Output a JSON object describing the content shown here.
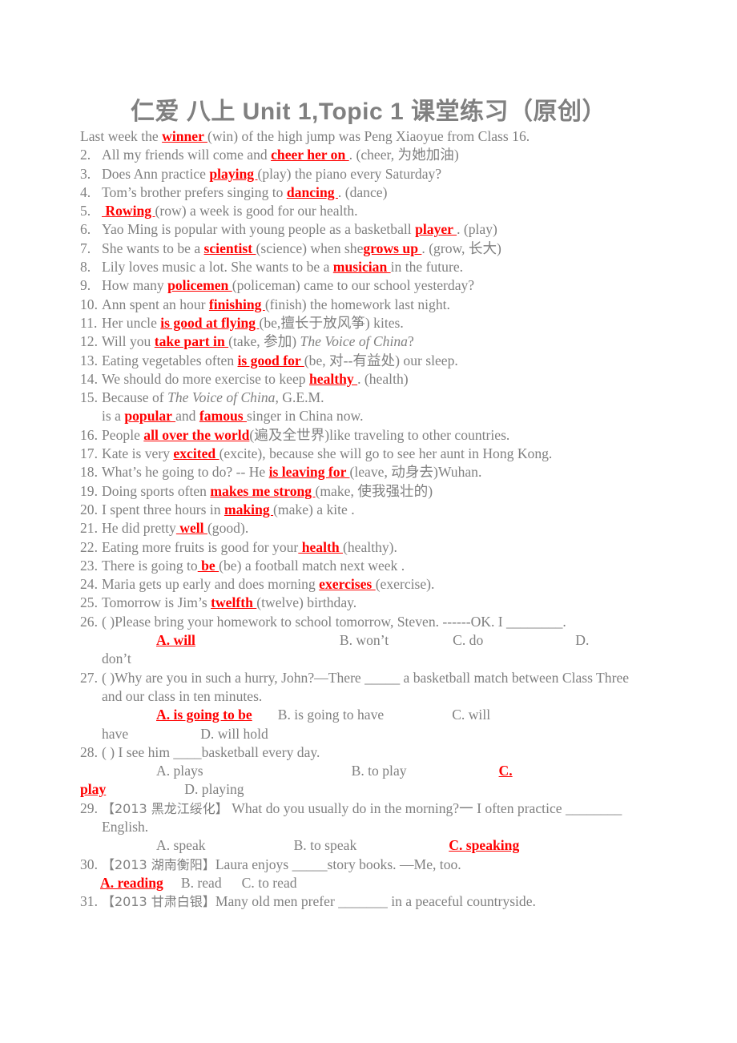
{
  "document": {
    "title": "仁爱 八上 Unit 1,Topic 1 课堂练习（原创）",
    "accent_color": "#ff0000",
    "body_color": "#808080"
  },
  "fill_in_questions": [
    {
      "number": "",
      "pre": "Last week the ",
      "answer": " winner  ",
      "post": "(win) of the high jump was Peng Xiaoyue from Class 16."
    },
    {
      "number": "2.",
      "pre": "All my friends will come and ",
      "answer": " cheer her on ",
      "post": ". (cheer, 为她加油)"
    },
    {
      "number": "3.",
      "pre": "Does Ann practice ",
      "answer": " playing  ",
      "post": "(play) the piano every Saturday?"
    },
    {
      "number": "4.",
      "pre": "Tom’s brother prefers singing to ",
      "answer": " dancing ",
      "post": ". (dance)"
    },
    {
      "number": "5.",
      "pre": "",
      "answer": "  Rowing ",
      "post": "(row) a week is good for our health."
    },
    {
      "number": "6.",
      "pre": "Yao Ming is popular with young people as a basketball ",
      "answer": "player  ",
      "post": ". (play)"
    },
    {
      "number": "7.",
      "pre": "She wants to be a ",
      "answer": "scientist ",
      "mid": "(science) when she",
      "answer2": "grows up  ",
      "post": " . (grow, 长大)"
    },
    {
      "number": "8.",
      "pre": "Lily loves music a lot. She wants to be a ",
      "answer": "musician  ",
      "post": "in the future."
    },
    {
      "number": "9.",
      "pre": "How many ",
      "answer": " policemen  ",
      "post": "(policeman) came to our school yesterday?"
    },
    {
      "number": "10.",
      "pre": "Ann spent an hour ",
      "answer": " finishing   ",
      "post": "(finish) the homework last night."
    },
    {
      "number": "11.",
      "pre": "Her uncle ",
      "answer": " is good at flying   ",
      "post": "(be,擅长于放风筝) kites."
    },
    {
      "number": "12.",
      "pre": "Will you ",
      "answer": " take part in  ",
      "post": "(take, 参加) ",
      "italic": "The Voice of China",
      "tail": "?"
    },
    {
      "number": "13.",
      "pre": "Eating vegetables often ",
      "answer": "  is good for   ",
      "post": "(be, 对--有益处) our sleep."
    },
    {
      "number": "14.",
      "pre": "We should do more exercise to keep ",
      "answer": " healthy  ",
      "post": ". (health)"
    },
    {
      "number": "15.",
      "pre": "Because of ",
      "italic": "The Voice of China",
      "post": ", G.E.M.",
      "wrap_pre": "is a ",
      "wrap_answer": "popular ",
      "wrap_mid": "and ",
      "wrap_answer2": "famous ",
      "wrap_post": "singer in China now."
    },
    {
      "number": "16.",
      "pre": "People ",
      "answer": "all over the world",
      "post": "(遍及全世界)like traveling to other countries."
    },
    {
      "number": "17.",
      "pre": "Kate is very ",
      "answer": " excited  ",
      "post": "(excite), because she will go to see her aunt in Hong Kong."
    },
    {
      "number": "18.",
      "pre": "What’s he going to do? -- He ",
      "answer": "is leaving for ",
      "post": "(leave, 动身去)Wuhan."
    },
    {
      "number": "19.",
      "pre": "Doing sports often ",
      "answer": " makes me strong  ",
      "post": "(make, 使我强壮的)"
    },
    {
      "number": "20.",
      "pre": "I spent three hours in ",
      "answer": " making ",
      "post": "(make) a  kite ."
    },
    {
      "number": "21.",
      "pre": "He did pretty",
      "answer": " well ",
      "post": "(good)."
    },
    {
      "number": "22.",
      "pre": "Eating more fruits is good for your",
      "answer": " health  ",
      "post": "(healthy)."
    },
    {
      "number": "23.",
      "pre": "There is going to",
      "answer": " be ",
      "post": "(be) a football match next week ."
    },
    {
      "number": "24.",
      "pre": "Maria gets up early and does morning ",
      "answer": " exercises   ",
      "post": "(exercise)."
    },
    {
      "number": "25.",
      "pre": "Tomorrow is Jim’s ",
      "answer": " twelfth  ",
      "post": "(twelve) birthday."
    }
  ],
  "multiple_choice": [
    {
      "number": "26.",
      "stem": "(  )Please bring your homework to school tomorrow, Steven. ------OK. I ________.",
      "options_row1": [
        {
          "label": "A. will",
          "correct": true
        },
        {
          "label": "B. won’t",
          "correct": false
        },
        {
          "label": "C. do",
          "correct": false
        },
        {
          "label": "D.",
          "correct": false
        }
      ],
      "options_row2": [
        {
          "label": "don’t",
          "correct": false
        }
      ]
    },
    {
      "number": "27.",
      "stem": "(  )Why are you in such a hurry, John?—There _____ a basketball match between Class Three",
      "stem_wrap": "and our class in ten minutes.",
      "options_row1": [
        {
          "label": "A. is going to be",
          "correct": true
        },
        {
          "label": "B. is going to have",
          "correct": false
        },
        {
          "label": "C. will",
          "correct": false
        }
      ],
      "options_row2": [
        {
          "label": "have",
          "correct": false
        },
        {
          "label": "D. will hold",
          "correct": false
        }
      ]
    },
    {
      "number": "28.",
      "stem": "(   ) I see him ____basketball every day.",
      "options_row1": [
        {
          "label": "A. plays",
          "correct": false
        },
        {
          "label": "B. to play",
          "correct": false
        },
        {
          "label": "C.",
          "correct": true
        }
      ],
      "options_row2": [
        {
          "label": "play",
          "correct": true
        },
        {
          "label": "D. playing",
          "correct": false
        }
      ]
    },
    {
      "number": "29.",
      "stem_cn": "【2013 黑龙江绥化】",
      "stem": " What do you usually do in the morning?一 I often practice ________",
      "stem_wrap": "English.",
      "options_row1": [
        {
          "label": "A. speak",
          "correct": false
        },
        {
          "label": "B. to speak",
          "correct": false
        },
        {
          "label": "C. speaking",
          "correct": true
        }
      ]
    },
    {
      "number": "30.",
      "stem_cn": "【2013 湖南衡阳】",
      "stem": "Laura enjoys _____story books.  —Me, too.",
      "options_row1": [
        {
          "label": "A. reading",
          "correct": true
        },
        {
          "label": "B. read",
          "correct": false
        },
        {
          "label": "C. to read",
          "correct": false
        }
      ]
    },
    {
      "number": "31.",
      "stem_cn": "【2013 甘肃白银】",
      "stem": "Many old men prefer _______ in a peaceful countryside."
    }
  ]
}
